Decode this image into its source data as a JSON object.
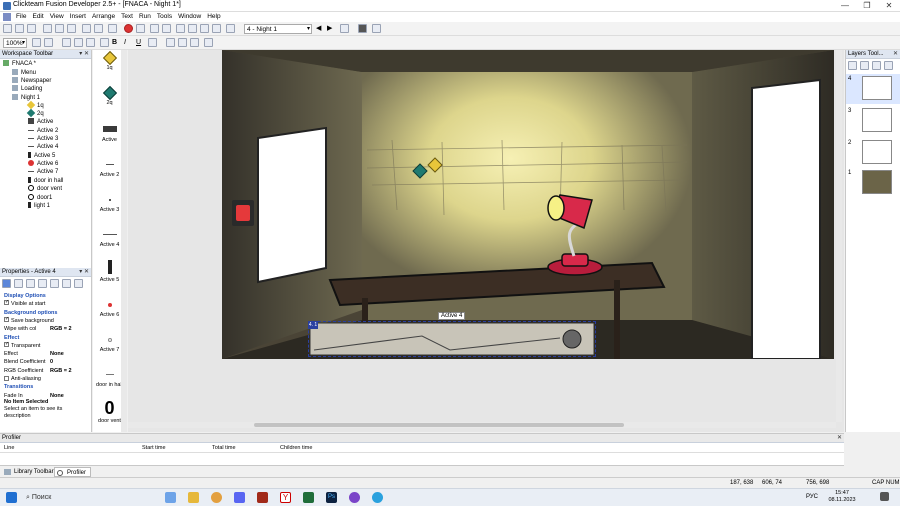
{
  "window": {
    "title": "Clickteam Fusion Developer 2.5+ - [FNACA - Night 1*]",
    "controls": [
      "—",
      "❐",
      "✕"
    ]
  },
  "menubar": {
    "items": [
      "File",
      "Edit",
      "View",
      "Insert",
      "Arrange",
      "Text",
      "Run",
      "Tools",
      "Window",
      "Help"
    ]
  },
  "toolbar": {
    "frame_selector": "4 - Night 1",
    "zoom": "100%"
  },
  "workspace": {
    "title": "Workspace Toolbar",
    "root": "FNACA *",
    "frames": [
      "Menu",
      "Newspaper",
      "Loading",
      "Night 1"
    ],
    "objects": [
      "1q",
      "2q",
      "Active",
      "Active 2",
      "Active 3",
      "Active 4",
      "Active 5",
      "Active 6",
      "Active 7",
      "door in hall",
      "door vent",
      "door1",
      "light 1"
    ]
  },
  "properties": {
    "title": "Properties - Active 4",
    "rows": [
      {
        "kind": "hdr",
        "text": "Display Options"
      },
      {
        "kind": "check",
        "text": "Visible at start",
        "checked": true
      },
      {
        "kind": "hdr",
        "text": "Background options"
      },
      {
        "kind": "check",
        "text": "Save background",
        "checked": true
      },
      {
        "kind": "pair",
        "text": "Wipe with col",
        "value": "RGB = 2"
      },
      {
        "kind": "hdr",
        "text": "Effect"
      },
      {
        "kind": "check",
        "text": "Transparent",
        "checked": true
      },
      {
        "kind": "pair",
        "text": "Effect",
        "value": "None"
      },
      {
        "kind": "pair",
        "text": "Blend Coefficient",
        "value": "0"
      },
      {
        "kind": "pair",
        "text": "RGB Coefficient",
        "value": "RGB = 2"
      },
      {
        "kind": "check",
        "text": "Anti-aliasing",
        "checked": false
      },
      {
        "kind": "hdr",
        "text": "Transitions"
      },
      {
        "kind": "pair",
        "text": "Fade In",
        "value": "None"
      }
    ],
    "info_title": "No Item Selected",
    "info_text": "Select an item to see its description"
  },
  "object_list": {
    "items": [
      "1q",
      "2q",
      "Active",
      "Active 2",
      "Active 3",
      "Active 4",
      "Active 5",
      "Active 6",
      "Active 7",
      "door in hall",
      "door vent"
    ]
  },
  "frame": {
    "selected_object_label": "Active 4",
    "selected_handle_label": "4. 1"
  },
  "layers": {
    "title": "Layers Tool...",
    "numbers": [
      "4",
      "3",
      "2",
      "1"
    ]
  },
  "profiler": {
    "title": "Profiler",
    "columns": [
      "Line",
      "Start time",
      "Total time",
      "Children time"
    ]
  },
  "tabs": {
    "library": "Library Toolbar",
    "profiler": "Profiler"
  },
  "status": {
    "coords1": "187, 638",
    "coords2": "606, 74",
    "coords3": "756, 698",
    "flags": "CAP  NUM"
  },
  "taskbar": {
    "search": "Поиск",
    "lang": "РУС",
    "time": "15:47",
    "date": "08.11.2023"
  },
  "colors": {
    "accent": "#1f4fb5",
    "wall": "#e6df9a",
    "lamp": "#d8294a"
  }
}
